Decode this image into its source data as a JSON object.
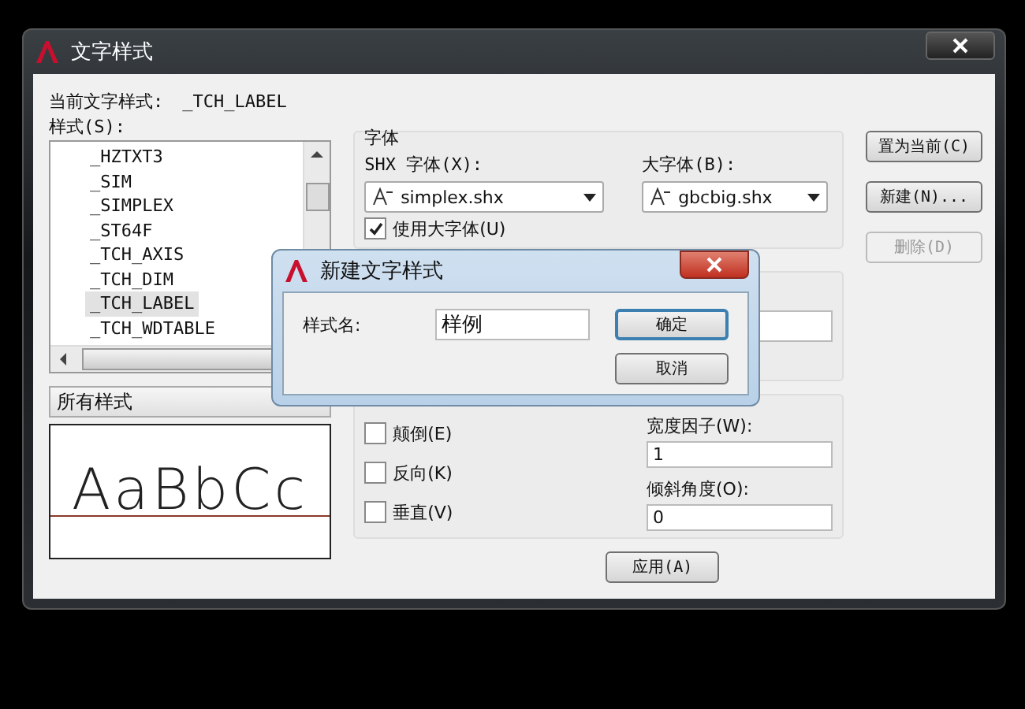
{
  "window": {
    "title": "文字样式"
  },
  "current_style": {
    "label": "当前文字样式:",
    "value": "_TCH_LABEL"
  },
  "styles": {
    "label": "样式(S):",
    "items": [
      {
        "name": "_HZTXT3",
        "selected": false
      },
      {
        "name": "_SIM",
        "selected": false
      },
      {
        "name": "_SIMPLEX",
        "selected": false
      },
      {
        "name": "_ST64F",
        "selected": false
      },
      {
        "name": "_TCH_AXIS",
        "selected": false
      },
      {
        "name": "_TCH_DIM",
        "selected": false
      },
      {
        "name": "_TCH_LABEL",
        "selected": true
      },
      {
        "name": "_TCH_WDTABLE",
        "selected": false
      }
    ]
  },
  "style_filter": {
    "value": "所有样式"
  },
  "preview": {
    "text": "AaBbCc"
  },
  "font": {
    "title": "字体",
    "shx_label": "SHX 字体(X):",
    "shx_value": "simplex.shx",
    "big_label": "大字体(B):",
    "big_value": "gbcbig.shx",
    "use_big": {
      "label": "使用大字体(U)",
      "checked": true
    }
  },
  "effects": {
    "checkboxes": [
      {
        "label": "颠倒(E)",
        "checked": false
      },
      {
        "label": "反向(K)",
        "checked": false
      },
      {
        "label": "垂直(V)",
        "checked": false
      }
    ],
    "fields": [
      {
        "label": "宽度因子(W):",
        "value": "1"
      },
      {
        "label": "倾斜角度(O):",
        "value": "0"
      }
    ]
  },
  "side_buttons": [
    {
      "label": "置为当前(C)",
      "disabled": false
    },
    {
      "label": "新建(N)...",
      "disabled": false
    },
    {
      "label": "删除(D)",
      "disabled": true
    }
  ],
  "apply_button": "应用(A)",
  "dialog": {
    "title": "新建文字样式",
    "field_label": "样式名:",
    "field_value": "样例",
    "buttons": [
      {
        "label": "确定",
        "default": true
      },
      {
        "label": "取消",
        "default": false
      }
    ]
  }
}
